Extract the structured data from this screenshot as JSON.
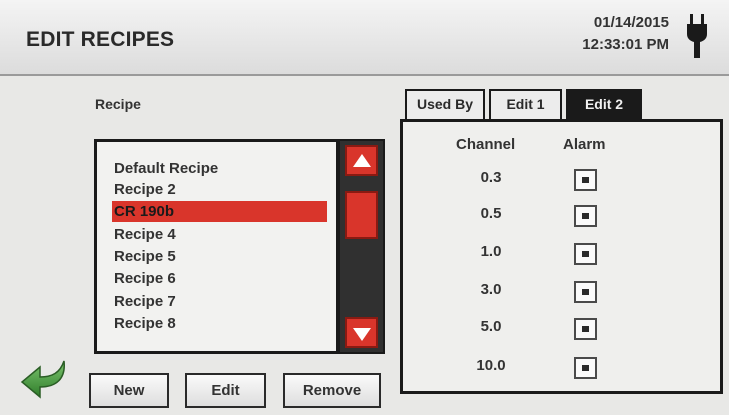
{
  "header": {
    "title": "EDIT RECIPES",
    "date": "01/14/2015",
    "time": "12:33:01 PM"
  },
  "recipe_section": {
    "label": "Recipe",
    "items": [
      {
        "label": "Default Recipe",
        "selected": false
      },
      {
        "label": "Recipe 2",
        "selected": false
      },
      {
        "label": "CR 190b",
        "selected": true
      },
      {
        "label": "Recipe 4",
        "selected": false
      },
      {
        "label": "Recipe 5",
        "selected": false
      },
      {
        "label": "Recipe 6",
        "selected": false
      },
      {
        "label": "Recipe 7",
        "selected": false
      },
      {
        "label": "Recipe 8",
        "selected": false
      }
    ]
  },
  "buttons": {
    "new": "New",
    "edit": "Edit",
    "remove": "Remove"
  },
  "tabs": [
    {
      "label": "Used By",
      "active": false
    },
    {
      "label": "Edit 1",
      "active": false
    },
    {
      "label": "Edit 2",
      "active": true
    }
  ],
  "alarm_table": {
    "channel_header": "Channel",
    "alarm_header": "Alarm",
    "rows": [
      {
        "channel": "0.3",
        "alarm": true
      },
      {
        "channel": "0.5",
        "alarm": true
      },
      {
        "channel": "1.0",
        "alarm": true
      },
      {
        "channel": "3.0",
        "alarm": true
      },
      {
        "channel": "5.0",
        "alarm": true
      },
      {
        "channel": "10.0",
        "alarm": true
      }
    ]
  },
  "colors": {
    "accent": "#d9352b",
    "dark": "#1a1a1a",
    "back_arrow": "#3f9a3a"
  },
  "icons": {
    "power": "plug-icon",
    "back": "back-arrow-icon",
    "scroll_up": "arrow-up-icon",
    "scroll_down": "arrow-down-icon"
  }
}
